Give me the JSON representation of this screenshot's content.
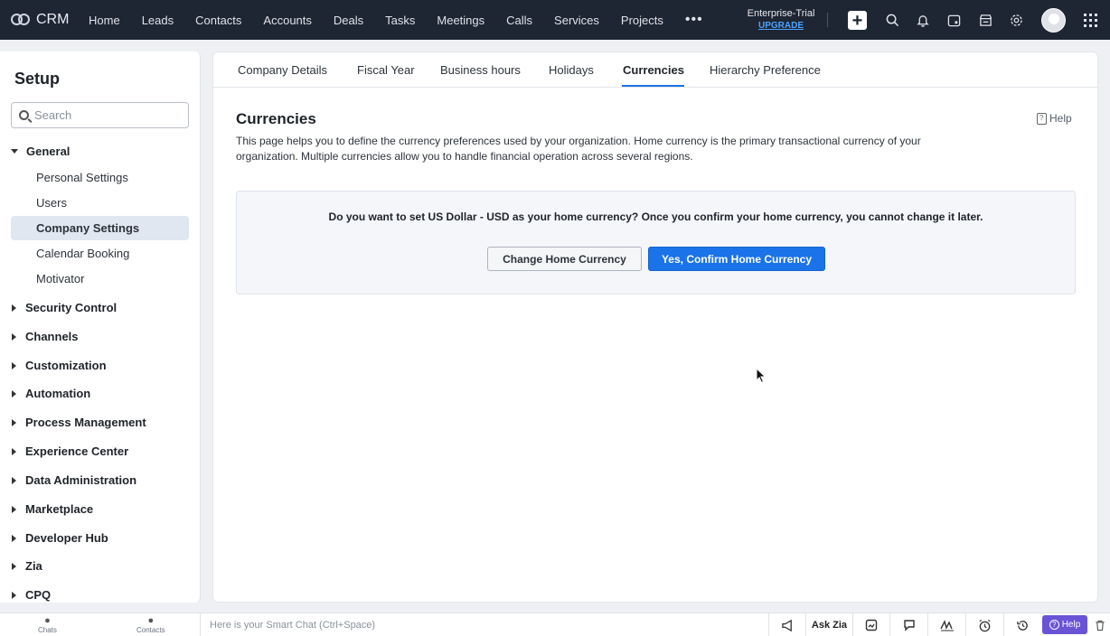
{
  "app": {
    "logo_text": "CRM"
  },
  "topnav": {
    "items": [
      "Home",
      "Leads",
      "Contacts",
      "Accounts",
      "Deals",
      "Tasks",
      "Meetings",
      "Calls",
      "Services",
      "Projects"
    ],
    "more": "•••",
    "trial_label": "Enterprise-Trial",
    "upgrade_label": "UPGRADE",
    "icons": [
      "plus-icon",
      "search-icon",
      "bell-icon",
      "calendar-icon",
      "store-icon",
      "gear-icon",
      "avatar",
      "apps-grid-icon"
    ]
  },
  "sidebar": {
    "title": "Setup",
    "search_placeholder": "Search",
    "general": {
      "label": "General",
      "items": [
        "Personal Settings",
        "Users",
        "Company Settings",
        "Calendar Booking",
        "Motivator"
      ],
      "active": "Company Settings"
    },
    "sections": [
      "Security Control",
      "Channels",
      "Customization",
      "Automation",
      "Process Management",
      "Experience Center",
      "Data Administration",
      "Marketplace",
      "Developer Hub",
      "Zia",
      "CPQ"
    ]
  },
  "tabs": {
    "items": [
      "Company Details",
      "Fiscal Year",
      "Business hours",
      "Holidays",
      "Currencies",
      "Hierarchy Preference"
    ],
    "active": "Currencies"
  },
  "content": {
    "title": "Currencies",
    "help_label": "Help",
    "description": "This page helps you to define the currency preferences used by your organization. Home currency is the primary transactional currency of your organization. Multiple currencies allow you to handle financial operation across several regions.",
    "confirm_text": "Do you want to set US Dollar - USD as your home currency? Once you confirm your home currency, you cannot change it later.",
    "change_button": "Change Home Currency",
    "confirm_button": "Yes, Confirm Home Currency"
  },
  "bottombar": {
    "chats": "Chats",
    "contacts": "Contacts",
    "smartchat_placeholder": "Here is your Smart Chat (Ctrl+Space)",
    "ask_zia": "Ask Zia",
    "help": "Help"
  },
  "colors": {
    "accent": "#1a73e8",
    "topbar": "#1e2533",
    "help_pill": "#6b53d6"
  }
}
